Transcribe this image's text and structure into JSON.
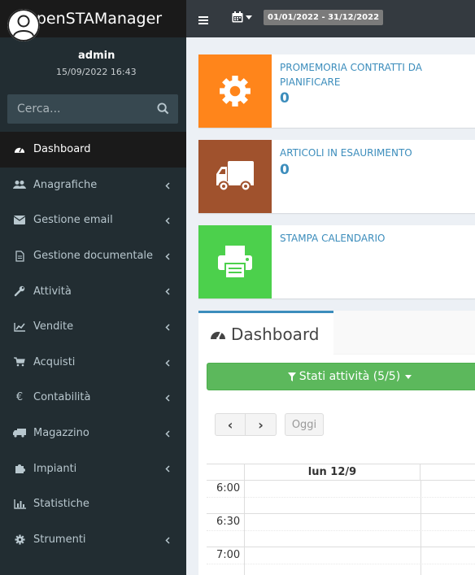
{
  "app": {
    "title": "OpenSTAManager"
  },
  "user": {
    "name": "admin",
    "datetime": "15/09/2022 16:43"
  },
  "search": {
    "placeholder": "Cerca..."
  },
  "topbar": {
    "period": "01/01/2022 - 31/12/2022"
  },
  "sidebar": {
    "items": [
      {
        "label": "Dashboard",
        "icon": "dashboard-icon",
        "active": true
      },
      {
        "label": "Anagrafiche",
        "icon": "users-icon"
      },
      {
        "label": "Gestione email",
        "icon": "envelope-icon"
      },
      {
        "label": "Gestione documentale",
        "icon": "file-icon"
      },
      {
        "label": "Attività",
        "icon": "wrench-icon"
      },
      {
        "label": "Vendite",
        "icon": "line-chart-icon"
      },
      {
        "label": "Acquisti",
        "icon": "cart-icon"
      },
      {
        "label": "Contabilità",
        "icon": "euro-icon"
      },
      {
        "label": "Magazzino",
        "icon": "truck-icon"
      },
      {
        "label": "Impianti",
        "icon": "puzzle-icon"
      },
      {
        "label": "Statistiche",
        "icon": "bar-chart-icon"
      },
      {
        "label": "Strumenti",
        "icon": "cog-icon"
      }
    ]
  },
  "infoboxes": [
    {
      "title": "PROMEMORIA CONTRATTI DA PIANIFICARE",
      "value": "0",
      "color": "#ff851b",
      "icon": "gear-icon"
    },
    {
      "title": "ARTICOLI IN ESAURIMENTO",
      "value": "0",
      "color": "#a0522d",
      "icon": "truck-icon"
    },
    {
      "title": "STAMPA CALENDARIO",
      "value": "",
      "color": "#4cd04c",
      "icon": "print-icon"
    }
  ],
  "panel": {
    "tab_label": "Dashboard",
    "filter_label": "Stati attività (5/5)",
    "prev": "‹",
    "next": "›",
    "today": "Oggi",
    "day_header": "lun 12/9",
    "times": [
      "6:00",
      "",
      "6:30",
      "",
      "7:00",
      ""
    ]
  },
  "colors": {
    "accent": "#3c8dbc",
    "sidebar": "#222d32",
    "success": "#5cb85c"
  }
}
